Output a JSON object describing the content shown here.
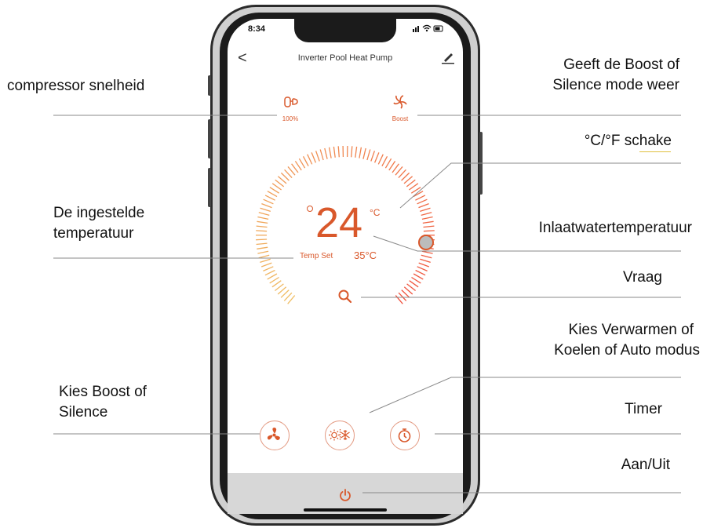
{
  "status_bar": {
    "time": "8:34",
    "icons": "▮▮ ◠ ▭"
  },
  "header": {
    "back": "<",
    "title": "Inverter Pool Heat Pump",
    "edit_icon": "edit-icon"
  },
  "indicators": {
    "compressor_value": "100%",
    "mode_value": "Boost"
  },
  "dial": {
    "temperature": "24",
    "unit": "°C",
    "temp_set_label": "Temp Set",
    "inlet_temperature": "35°C",
    "accent_color": "#d9582b"
  },
  "buttons": {
    "fan_icon": "fan-icon",
    "mode_icon": "sun-snowflake-icon",
    "timer_icon": "timer-icon",
    "power_icon": "power-icon"
  },
  "annotations": {
    "compressor_speed": "compressor snelheid",
    "boost_silence_display_1": "Geeft de Boost of",
    "boost_silence_display_2": "Silence mode weer",
    "unit_switch": "°C/°F  schake",
    "set_temperature_1": "De ingestelde",
    "set_temperature_2": "temperatuur",
    "inlet_temperature": "Inlaatwatertemperatuur",
    "query": "Vraag",
    "mode_select_1": "Kies Verwarmen of",
    "mode_select_2": "Koelen of Auto modus",
    "boost_silence_select_1": "Kies Boost of",
    "boost_silence_select_2": "Silence",
    "timer": "Timer",
    "power": "Aan/Uit"
  }
}
